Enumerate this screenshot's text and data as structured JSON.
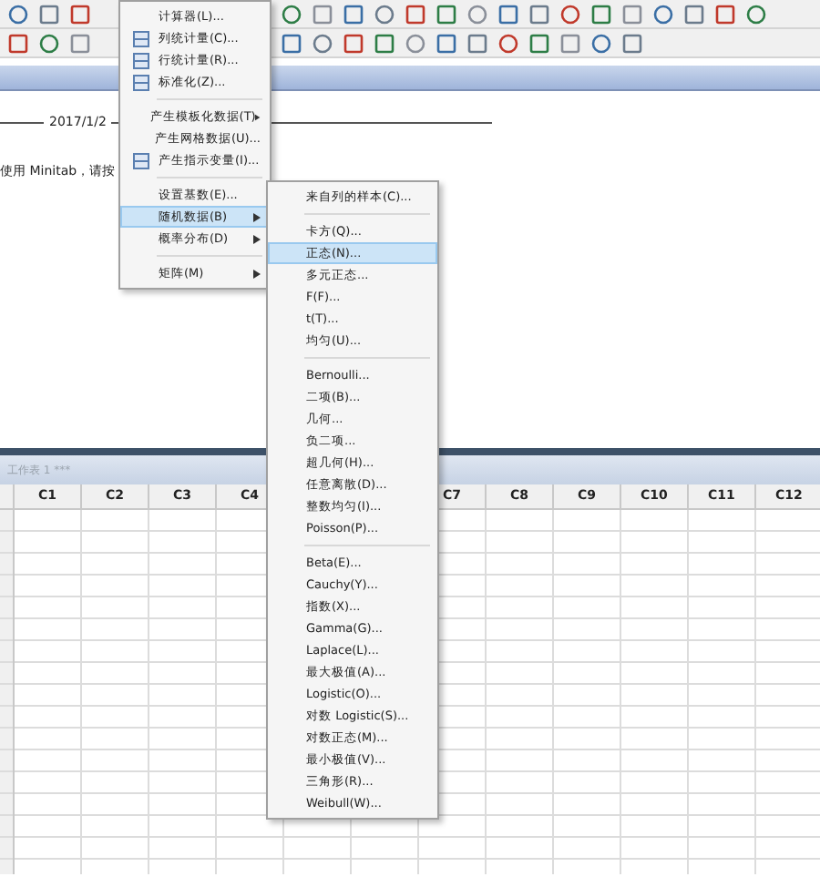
{
  "session": {
    "date": "2017/1/2",
    "message": "使用 Minitab，请按"
  },
  "worksheet": {
    "title": "工作表 1 ***",
    "columns": [
      "C1",
      "C2",
      "C3",
      "C4",
      "C7",
      "C8",
      "C9",
      "C10",
      "C11",
      "C12"
    ]
  },
  "calc_menu": [
    {
      "kind": "item",
      "label": "计算器(L)...",
      "icon": false,
      "submenu": false,
      "selected": false
    },
    {
      "kind": "item",
      "label": "列统计量(C)...",
      "icon": true,
      "submenu": false,
      "selected": false
    },
    {
      "kind": "item",
      "label": "行统计量(R)...",
      "icon": true,
      "submenu": false,
      "selected": false
    },
    {
      "kind": "item",
      "label": "标准化(Z)...",
      "icon": true,
      "submenu": false,
      "selected": false
    },
    {
      "kind": "separator"
    },
    {
      "kind": "item",
      "label": "产生模板化数据(T)",
      "icon": false,
      "submenu": true,
      "selected": false
    },
    {
      "kind": "item",
      "label": "产生网格数据(U)...",
      "icon": false,
      "submenu": false,
      "selected": false
    },
    {
      "kind": "item",
      "label": "产生指示变量(I)...",
      "icon": true,
      "submenu": false,
      "selected": false
    },
    {
      "kind": "separator"
    },
    {
      "kind": "item",
      "label": "设置基数(E)...",
      "icon": false,
      "submenu": false,
      "selected": false
    },
    {
      "kind": "item",
      "label": "随机数据(B)",
      "icon": false,
      "submenu": true,
      "selected": true
    },
    {
      "kind": "item",
      "label": "概率分布(D)",
      "icon": false,
      "submenu": true,
      "selected": false
    },
    {
      "kind": "separator"
    },
    {
      "kind": "item",
      "label": "矩阵(M)",
      "icon": false,
      "submenu": true,
      "selected": false
    }
  ],
  "random_menu": [
    {
      "kind": "item",
      "label": "来自列的样本(C)...",
      "selected": false
    },
    {
      "kind": "separator"
    },
    {
      "kind": "item",
      "label": "卡方(Q)...",
      "selected": false
    },
    {
      "kind": "item",
      "label": "正态(N)...",
      "selected": true
    },
    {
      "kind": "item",
      "label": "多元正态...",
      "selected": false
    },
    {
      "kind": "item",
      "label": "F(F)...",
      "selected": false
    },
    {
      "kind": "item",
      "label": "t(T)...",
      "selected": false
    },
    {
      "kind": "item",
      "label": "均匀(U)...",
      "selected": false
    },
    {
      "kind": "separator"
    },
    {
      "kind": "item",
      "label": "Bernoulli...",
      "selected": false
    },
    {
      "kind": "item",
      "label": "二项(B)...",
      "selected": false
    },
    {
      "kind": "item",
      "label": "几何...",
      "selected": false
    },
    {
      "kind": "item",
      "label": "负二项...",
      "selected": false
    },
    {
      "kind": "item",
      "label": "超几何(H)...",
      "selected": false
    },
    {
      "kind": "item",
      "label": "任意离散(D)...",
      "selected": false
    },
    {
      "kind": "item",
      "label": "整数均匀(I)...",
      "selected": false
    },
    {
      "kind": "item",
      "label": "Poisson(P)...",
      "selected": false
    },
    {
      "kind": "separator"
    },
    {
      "kind": "item",
      "label": "Beta(E)...",
      "selected": false
    },
    {
      "kind": "item",
      "label": "Cauchy(Y)...",
      "selected": false
    },
    {
      "kind": "item",
      "label": "指数(X)...",
      "selected": false
    },
    {
      "kind": "item",
      "label": "Gamma(G)...",
      "selected": false
    },
    {
      "kind": "item",
      "label": "Laplace(L)...",
      "selected": false
    },
    {
      "kind": "item",
      "label": "最大极值(A)...",
      "selected": false
    },
    {
      "kind": "item",
      "label": "Logistic(O)...",
      "selected": false
    },
    {
      "kind": "item",
      "label": "对数 Logistic(S)...",
      "selected": false
    },
    {
      "kind": "item",
      "label": "对数正态(M)...",
      "selected": false
    },
    {
      "kind": "item",
      "label": "最小极值(V)...",
      "selected": false
    },
    {
      "kind": "item",
      "label": "三角形(R)...",
      "selected": false
    },
    {
      "kind": "item",
      "label": "Weibull(W)...",
      "selected": false
    }
  ]
}
